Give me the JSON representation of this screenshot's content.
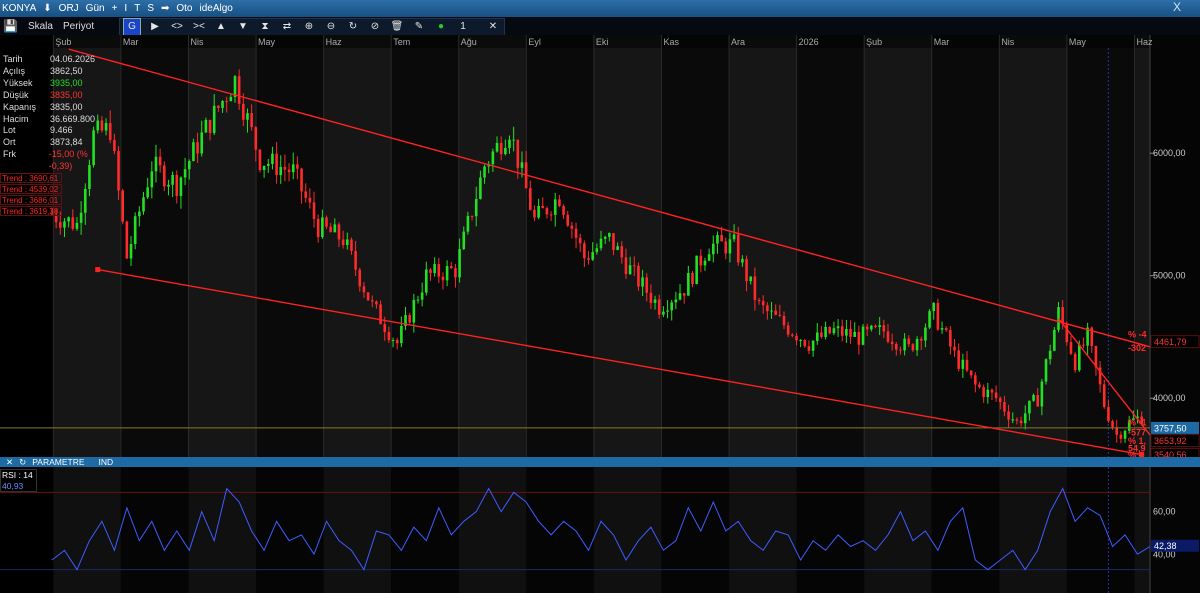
{
  "topbar": {
    "symbol": "KONYA",
    "items": [
      "ORJ",
      "Gün",
      "+",
      "I",
      "T",
      "S",
      "Oto",
      "ideAlgo"
    ],
    "close": "X"
  },
  "toolbar": {
    "labels": [
      "Skala",
      "Periyot"
    ],
    "tool_g": "G",
    "tool_icons": [
      "play-icon",
      "expand-icon",
      "collapse-icon",
      "arrow-up-icon",
      "arrow-down-icon",
      "hourglass-icon",
      "swap-icon",
      "plus-circle-icon",
      "minus-circle-icon",
      "refresh-icon",
      "no-icon",
      "trash-icon",
      "pen-icon",
      "green-dot-icon"
    ],
    "tool_count": "1",
    "tool_close": "✕"
  },
  "info": [
    {
      "k": "Tarih",
      "v": "04.06.2026",
      "c": "#dddddd"
    },
    {
      "k": "Açılış",
      "v": "3862,50",
      "c": "#dddddd"
    },
    {
      "k": "Yüksek",
      "v": "3935,00",
      "c": "#22dd22"
    },
    {
      "k": "Düşük",
      "v": "3835,00",
      "c": "#ff3333"
    },
    {
      "k": "Kapanış",
      "v": "3835,00",
      "c": "#dddddd"
    },
    {
      "k": "Hacim",
      "v": "36.669.800",
      "c": "#dddddd"
    },
    {
      "k": "Lot",
      "v": "9.466",
      "c": "#dddddd"
    },
    {
      "k": "Ort",
      "v": "3873,84",
      "c": "#dddddd"
    },
    {
      "k": "Frk",
      "v": "-15,00 (% -0,39)",
      "c": "#ff3333"
    }
  ],
  "trends": [
    "Trend : 3690,61",
    "Trend : 4539,02",
    "Trend : 3686,01",
    "Trend : 3619,38"
  ],
  "chart_data": {
    "type": "candlestick",
    "x_ticks": [
      "Şub",
      "Mar",
      "Nis",
      "May",
      "Haz",
      "Tem",
      "Ağu",
      "Eyl",
      "Eki",
      "Kas",
      "Ara",
      "2026",
      "Şub",
      "Mar",
      "Nis",
      "May",
      "Haz"
    ],
    "y_ticks": [
      6000,
      5000,
      4000
    ],
    "y_tick_labels": [
      "6000,00",
      "5000,00",
      "4000,00"
    ],
    "ylim": [
      3520,
      6900
    ],
    "price_path": [
      [
        0,
        5500
      ],
      [
        6,
        5420
      ],
      [
        10,
        6150
      ],
      [
        14,
        6200
      ],
      [
        18,
        5150
      ],
      [
        24,
        5900
      ],
      [
        30,
        5750
      ],
      [
        37,
        6200
      ],
      [
        44,
        6600
      ],
      [
        50,
        5950
      ],
      [
        58,
        5850
      ],
      [
        64,
        5400
      ],
      [
        70,
        5300
      ],
      [
        77,
        4750
      ],
      [
        83,
        4450
      ],
      [
        90,
        5000
      ],
      [
        97,
        5050
      ],
      [
        104,
        5900
      ],
      [
        110,
        6200
      ],
      [
        116,
        5450
      ],
      [
        122,
        5650
      ],
      [
        128,
        5150
      ],
      [
        134,
        5300
      ],
      [
        140,
        5000
      ],
      [
        146,
        4750
      ],
      [
        152,
        4900
      ],
      [
        158,
        5250
      ],
      [
        164,
        5250
      ],
      [
        170,
        4750
      ],
      [
        176,
        4600
      ],
      [
        182,
        4450
      ],
      [
        188,
        4550
      ],
      [
        194,
        4500
      ],
      [
        200,
        4550
      ],
      [
        206,
        4400
      ],
      [
        212,
        4700
      ],
      [
        217,
        4350
      ],
      [
        222,
        4100
      ],
      [
        227,
        4000
      ],
      [
        232,
        3800
      ],
      [
        237,
        4000
      ],
      [
        242,
        4700
      ],
      [
        246,
        4300
      ],
      [
        249,
        4500
      ],
      [
        253,
        3950
      ],
      [
        256,
        3700
      ],
      [
        259,
        3800
      ],
      [
        262,
        3850
      ]
    ],
    "horizontal_line": 3757.5,
    "channel_upper": [
      [
        4,
        6850
      ],
      [
        264,
        4420
      ]
    ],
    "channel_lower": [
      [
        11,
        5050
      ],
      [
        262,
        3540
      ]
    ],
    "short_line": [
      [
        242,
        4650
      ],
      [
        264,
        3700
      ]
    ],
    "right_labels": [
      {
        "text": "4461,79",
        "y": 4461.79,
        "bg": "#000000",
        "color": "#ff3333"
      },
      {
        "text": "3757,50",
        "y": 3757.5,
        "bg": "#1d6aa5",
        "color": "#ffffff"
      },
      {
        "text": "3653,92",
        "y": 3653.92,
        "bg": "#000000",
        "color": "#ff3333"
      },
      {
        "text": "3540,56",
        "y": 3540.56,
        "bg": "#000000",
        "color": "#ff3333"
      }
    ],
    "annotations": [
      {
        "text": "% -4",
        "y": 4520
      },
      {
        "text": "-302",
        "y": 4410
      },
      {
        "text": "% -1",
        "y": 3800
      },
      {
        "text": "-577",
        "y": 3720
      },
      {
        "text": "% 1,",
        "y": 3650
      },
      {
        "text": "54,9",
        "y": 3590
      },
      {
        "text": "% -",
        "y": 3535
      }
    ]
  },
  "parametre": {
    "close": "✕",
    "refresh": "↻",
    "title": "PARAMETRE",
    "ind": "IND"
  },
  "rsi": {
    "label": "RSI : 14",
    "value": "40,93",
    "ylim": [
      20,
      80
    ],
    "y_tick": "60,00",
    "last": "42,38",
    "partial_tick": "40,00",
    "ref_lines": [
      70,
      30
    ],
    "path": [
      [
        0,
        35
      ],
      [
        3,
        40
      ],
      [
        6,
        30
      ],
      [
        9,
        45
      ],
      [
        12,
        55
      ],
      [
        15,
        40
      ],
      [
        18,
        62
      ],
      [
        21,
        45
      ],
      [
        24,
        55
      ],
      [
        27,
        40
      ],
      [
        30,
        50
      ],
      [
        33,
        40
      ],
      [
        36,
        60
      ],
      [
        39,
        45
      ],
      [
        42,
        72
      ],
      [
        45,
        65
      ],
      [
        48,
        50
      ],
      [
        51,
        40
      ],
      [
        54,
        55
      ],
      [
        57,
        45
      ],
      [
        60,
        48
      ],
      [
        63,
        38
      ],
      [
        66,
        55
      ],
      [
        69,
        45
      ],
      [
        72,
        40
      ],
      [
        75,
        30
      ],
      [
        78,
        50
      ],
      [
        81,
        48
      ],
      [
        84,
        40
      ],
      [
        87,
        52
      ],
      [
        90,
        45
      ],
      [
        93,
        62
      ],
      [
        96,
        48
      ],
      [
        99,
        55
      ],
      [
        102,
        60
      ],
      [
        105,
        72
      ],
      [
        108,
        60
      ],
      [
        111,
        70
      ],
      [
        114,
        65
      ],
      [
        117,
        55
      ],
      [
        120,
        48
      ],
      [
        123,
        55
      ],
      [
        126,
        50
      ],
      [
        129,
        40
      ],
      [
        132,
        55
      ],
      [
        135,
        48
      ],
      [
        138,
        35
      ],
      [
        141,
        45
      ],
      [
        144,
        52
      ],
      [
        147,
        40
      ],
      [
        150,
        45
      ],
      [
        153,
        62
      ],
      [
        156,
        50
      ],
      [
        159,
        65
      ],
      [
        162,
        50
      ],
      [
        165,
        55
      ],
      [
        168,
        45
      ],
      [
        171,
        40
      ],
      [
        174,
        50
      ],
      [
        177,
        48
      ],
      [
        180,
        35
      ],
      [
        183,
        45
      ],
      [
        186,
        40
      ],
      [
        189,
        48
      ],
      [
        192,
        42
      ],
      [
        195,
        45
      ],
      [
        198,
        40
      ],
      [
        201,
        48
      ],
      [
        204,
        60
      ],
      [
        207,
        45
      ],
      [
        210,
        50
      ],
      [
        213,
        40
      ],
      [
        216,
        55
      ],
      [
        219,
        62
      ],
      [
        222,
        35
      ],
      [
        225,
        30
      ],
      [
        228,
        35
      ],
      [
        231,
        40
      ],
      [
        234,
        30
      ],
      [
        237,
        40
      ],
      [
        240,
        60
      ],
      [
        243,
        72
      ],
      [
        246,
        55
      ],
      [
        249,
        62
      ],
      [
        252,
        58
      ],
      [
        255,
        42
      ],
      [
        258,
        48
      ],
      [
        261,
        38
      ],
      [
        264,
        42
      ]
    ]
  }
}
